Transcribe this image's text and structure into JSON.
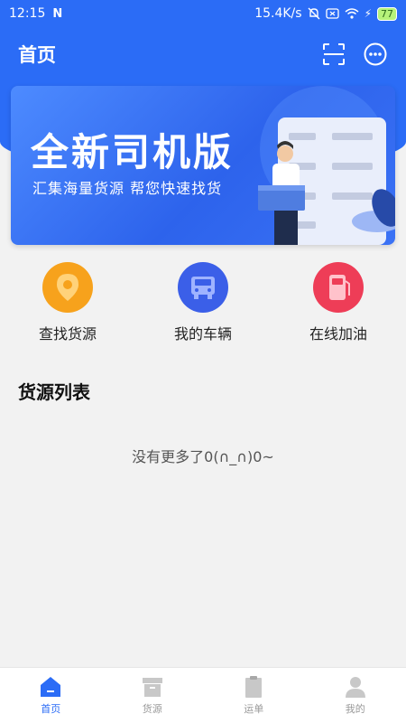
{
  "status_bar": {
    "time": "12:15",
    "network_speed": "15.4K/s",
    "battery": "77"
  },
  "header": {
    "title": "首页"
  },
  "banner": {
    "headline": "全新司机版",
    "subtitle": "汇集海量货源  帮您快速找货"
  },
  "quick_actions": [
    {
      "label": "查找货源",
      "icon": "location-pin-icon",
      "color": "#f7a21c"
    },
    {
      "label": "我的车辆",
      "icon": "truck-icon",
      "color": "#3b5fe8"
    },
    {
      "label": "在线加油",
      "icon": "fuel-pump-icon",
      "color": "#ee3d57"
    }
  ],
  "section": {
    "title": "货源列表",
    "empty_text": "没有更多了0(∩_∩)0~"
  },
  "tabbar": {
    "items": [
      {
        "label": "首页",
        "icon": "home-icon",
        "active": true
      },
      {
        "label": "货源",
        "icon": "box-icon",
        "active": false
      },
      {
        "label": "运单",
        "icon": "clipboard-icon",
        "active": false
      },
      {
        "label": "我的",
        "icon": "user-icon",
        "active": false
      }
    ]
  },
  "colors": {
    "primary": "#2b6cf6",
    "background": "#f2f2f2"
  }
}
